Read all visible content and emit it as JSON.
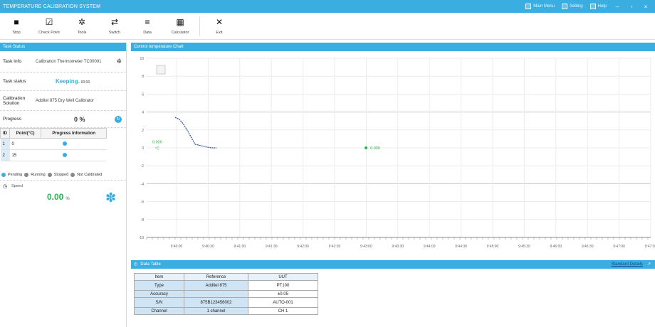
{
  "titlebar": {
    "title": "TEMPERATURE CALIBRATION SYSTEM",
    "items": [
      {
        "label": "Main Menu",
        "icon": "window-icon"
      },
      {
        "label": "Setting",
        "icon": "settings-icon"
      },
      {
        "label": "Help",
        "icon": "help-icon"
      }
    ]
  },
  "toolbar": [
    {
      "label": "Stop",
      "icon": "stop-icon",
      "glyph": "■"
    },
    {
      "label": "Check Point",
      "icon": "checkbox-icon",
      "glyph": "☑"
    },
    {
      "label": "Tools",
      "icon": "gear-icon",
      "glyph": "✲"
    },
    {
      "label": "Switch",
      "icon": "switch-icon",
      "glyph": "⇄"
    },
    {
      "label": "Data",
      "icon": "database-icon",
      "glyph": "≡"
    },
    {
      "label": "Calculator",
      "icon": "calculator-icon",
      "glyph": "▦"
    },
    {
      "label": "Exit",
      "icon": "close-icon",
      "glyph": "✕"
    }
  ],
  "left": {
    "header": "Task Status",
    "task_info_label": "Task Info",
    "task_info_value": "Calibration Thermometer TC00001",
    "status_label": "Task status",
    "status_value": "Keeping",
    "status_sub": "...00:00",
    "solution_label": "Calibration Solution",
    "solution_value": "Additel 875 Dry Well Calibrator",
    "progress_label": "Progress",
    "progress_value": "0 %",
    "steps_headers": [
      "ID",
      "Point(°C)",
      "Progress Information"
    ],
    "steps": [
      {
        "id": "1",
        "point": "0"
      },
      {
        "id": "2",
        "point": "15"
      }
    ],
    "legend": [
      "Pending",
      "Running",
      "Stopped",
      "Not Calibrated"
    ],
    "speed_label": "Speed",
    "fan_value": "0.00",
    "fan_unit": "%"
  },
  "chart": {
    "header": "Control temperature Chart",
    "y_ticks": [
      "10",
      "8",
      "6",
      "4",
      "2",
      "0",
      "-2",
      "-4",
      "-6",
      "-8",
      "-10"
    ],
    "x_ticks": [
      "9:40:00",
      "9:40:30",
      "9:41:00",
      "9:41:30",
      "9:42:00",
      "9:42:30",
      "9:43:00",
      "9:43:30",
      "9:44:00",
      "9:44:30",
      "9:45:00",
      "9:45:30",
      "9:46:00",
      "9:46:30",
      "9:47:00",
      "9:47:30"
    ],
    "left_label": "0.000",
    "left_label_sub": "°C",
    "right_label": "0.000"
  },
  "chart_data": {
    "type": "line",
    "series": [
      {
        "values": [
          3.4,
          3.2,
          2.7,
          2.0,
          1.2,
          0.4,
          0.1,
          0.0,
          0.0
        ]
      }
    ],
    "ylim": [
      -10,
      10
    ]
  },
  "bottom": {
    "header": "Data Table",
    "link": "Standard Details",
    "rows": [
      [
        "Item",
        "Reference",
        "UUT"
      ],
      [
        "Type",
        "Additel 875",
        "PT100"
      ],
      [
        "Accuracy",
        "",
        "±0.05"
      ],
      [
        "S/N",
        "875B123456002",
        "AUTO-001"
      ],
      [
        "Channel",
        "1 channel",
        "CH 1"
      ]
    ]
  }
}
